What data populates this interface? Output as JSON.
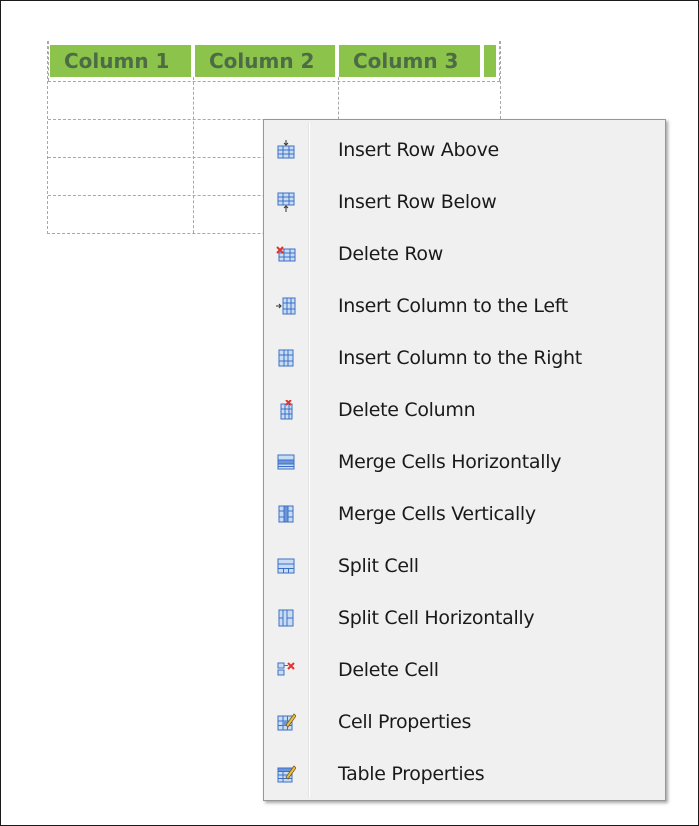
{
  "table": {
    "headers": [
      "Column 1",
      "Column 2",
      "Column 3"
    ]
  },
  "context_menu": {
    "items": [
      {
        "label": "Insert Row Above",
        "icon": "insert-row-above-icon"
      },
      {
        "label": "Insert Row Below",
        "icon": "insert-row-below-icon"
      },
      {
        "label": "Delete Row",
        "icon": "delete-row-icon"
      },
      {
        "label": "Insert Column to the Left",
        "icon": "insert-column-left-icon"
      },
      {
        "label": "Insert Column to the Right",
        "icon": "insert-column-right-icon"
      },
      {
        "label": "Delete Column",
        "icon": "delete-column-icon"
      },
      {
        "label": "Merge Cells Horizontally",
        "icon": "merge-cells-horizontally-icon"
      },
      {
        "label": "Merge Cells Vertically",
        "icon": "merge-cells-vertically-icon"
      },
      {
        "label": "Split Cell",
        "icon": "split-cell-icon"
      },
      {
        "label": "Split Cell Horizontally",
        "icon": "split-cell-horizontally-icon"
      },
      {
        "label": "Delete Cell",
        "icon": "delete-cell-icon"
      },
      {
        "label": "Cell Properties",
        "icon": "cell-properties-icon"
      },
      {
        "label": "Table Properties",
        "icon": "table-properties-icon"
      }
    ]
  },
  "colors": {
    "header_bg": "#8cc34a",
    "header_text": "#4d6c46",
    "menu_bg": "#f0f0f0",
    "icon_blue": "#3d6fc4",
    "icon_red": "#e0342c"
  }
}
